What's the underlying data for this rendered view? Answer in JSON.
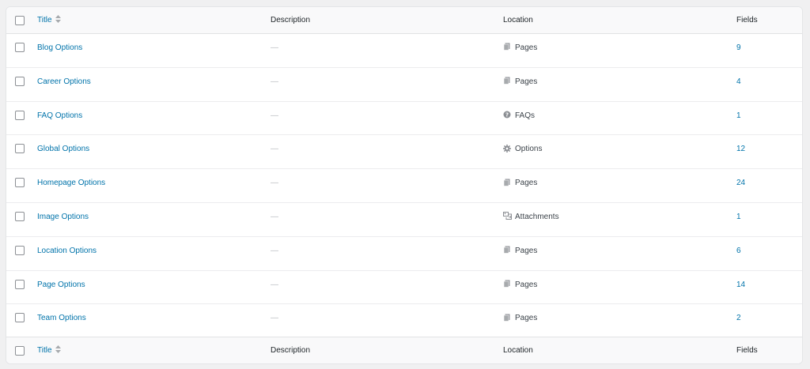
{
  "columns": {
    "title": "Title",
    "description": "Description",
    "location": "Location",
    "fields": "Fields"
  },
  "rows": [
    {
      "title": "Blog Options",
      "description": "—",
      "location": "Pages",
      "location_icon": "pages-icon",
      "fields": "9"
    },
    {
      "title": "Career Options",
      "description": "—",
      "location": "Pages",
      "location_icon": "pages-icon",
      "fields": "4"
    },
    {
      "title": "FAQ Options",
      "description": "—",
      "location": "FAQs",
      "location_icon": "help-icon",
      "fields": "1"
    },
    {
      "title": "Global Options",
      "description": "—",
      "location": "Options",
      "location_icon": "gear-icon",
      "fields": "12"
    },
    {
      "title": "Homepage Options",
      "description": "—",
      "location": "Pages",
      "location_icon": "pages-icon",
      "fields": "24"
    },
    {
      "title": "Image Options",
      "description": "—",
      "location": "Attachments",
      "location_icon": "media-icon",
      "fields": "1"
    },
    {
      "title": "Location Options",
      "description": "—",
      "location": "Pages",
      "location_icon": "pages-icon",
      "fields": "6"
    },
    {
      "title": "Page Options",
      "description": "—",
      "location": "Pages",
      "location_icon": "pages-icon",
      "fields": "14"
    },
    {
      "title": "Team Options",
      "description": "—",
      "location": "Pages",
      "location_icon": "pages-icon",
      "fields": "2"
    }
  ],
  "colors": {
    "link": "#0073aa",
    "header_bg": "#f9f9fa",
    "page_bg": "#f0f0f1"
  }
}
